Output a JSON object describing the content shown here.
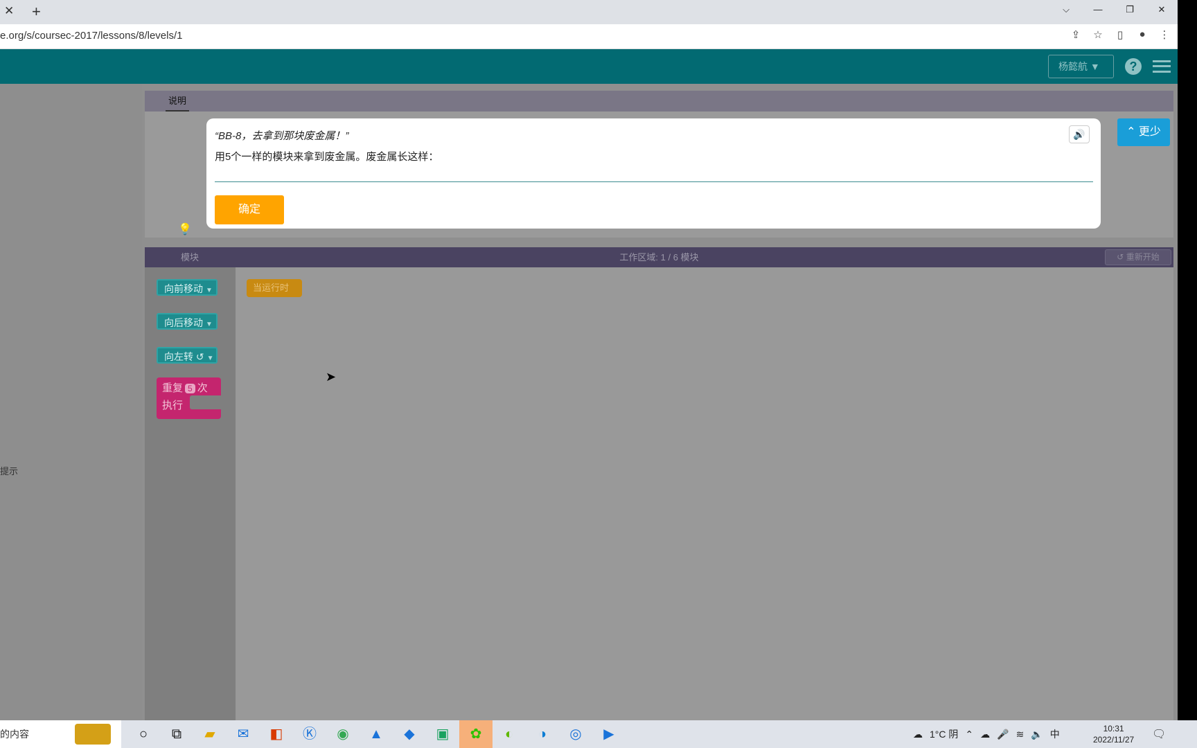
{
  "browser": {
    "tab_close": "✕",
    "tab_new": "+",
    "url": "e.org/s/coursec-2017/lessons/8/levels/1",
    "window_controls": [
      "⌵",
      "—",
      "❐",
      "✕"
    ]
  },
  "header": {
    "user_name": "杨懿航",
    "help": "?"
  },
  "left_pane": {
    "hint": "提示"
  },
  "instructions": {
    "tab_label": "说明",
    "quote": "“BB-8，去拿到那块废金属！”",
    "body": "用5个一样的模块来拿到废金属。废金属长这样：",
    "ok_label": "确定",
    "less_label": "更少"
  },
  "workspace": {
    "blocks_label": "模块",
    "count_label": "工作区域: 1 / 6 模块",
    "reset_label": "重新开始",
    "toolbox": [
      {
        "label": "向前移动"
      },
      {
        "label": "向后移动"
      },
      {
        "label": "向左转 ↺"
      }
    ],
    "repeat": {
      "prefix": "重复",
      "count": "5",
      "suffix": "次",
      "do": "执行"
    },
    "when_run": "当运行时"
  },
  "taskbar": {
    "search_text": "的内容",
    "weather": "1°C 阴",
    "ime": "中",
    "time": "10:31",
    "date": "2022/11/27"
  }
}
